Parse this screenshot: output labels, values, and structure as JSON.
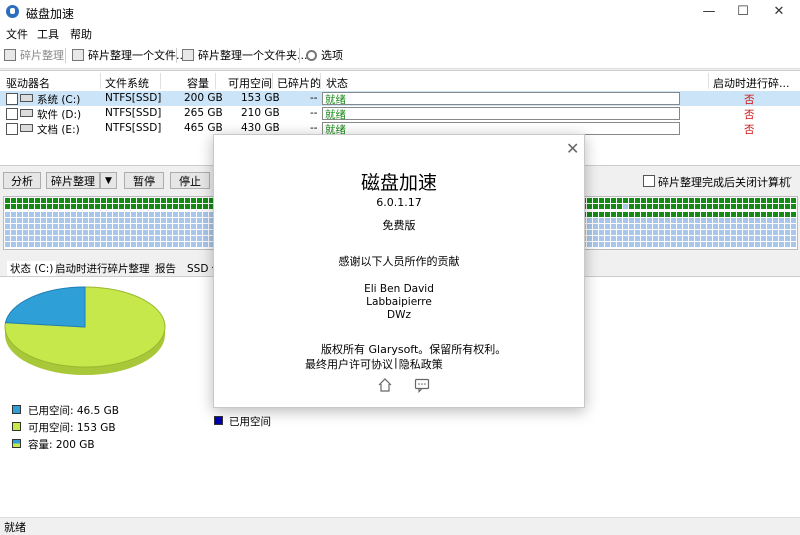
{
  "window": {
    "title": "磁盘加速",
    "min": "—",
    "max": "☐",
    "close": "✕"
  },
  "menu": [
    "文件",
    "工具",
    "帮助"
  ],
  "toolbar": {
    "defrag": "碎片整理",
    "defrag_file": "碎片整理一个文件...",
    "defrag_folder": "碎片整理一个文件夹...",
    "options": "选项"
  },
  "columns": {
    "drive": "驱动器名",
    "fs": "文件系统",
    "capacity": "容量",
    "free": "可用空间",
    "fragmented": "已碎片的",
    "status": "状态",
    "boot": "启动时进行碎..."
  },
  "drives": [
    {
      "name": "系统 (C:)",
      "fs": "NTFS[SSD]",
      "capacity": "200 GB",
      "free": "153 GB",
      "frag": "--",
      "status": "就绪",
      "boot": "否"
    },
    {
      "name": "软件 (D:)",
      "fs": "NTFS[SSD]",
      "capacity": "265 GB",
      "free": "210 GB",
      "frag": "--",
      "status": "就绪",
      "boot": "否"
    },
    {
      "name": "文档 (E:)",
      "fs": "NTFS[SSD]",
      "capacity": "465 GB",
      "free": "430 GB",
      "frag": "--",
      "status": "就绪",
      "boot": "否"
    }
  ],
  "actions": {
    "analyze": "分析",
    "defrag": "碎片整理",
    "dropdown": "▼",
    "pause": "暂停",
    "stop": "停止",
    "shutdown_label": "碎片整理完成后关闭计算机"
  },
  "tabs": [
    "状态 (C:)",
    "启动时进行碎片整理",
    "报告",
    "SSD 优"
  ],
  "legend": {
    "used": "已用空间: 46.5 GB",
    "free": "可用空间: 153 GB",
    "capacity": "容量: 200 GB",
    "used_right": "已用空间"
  },
  "pie": {
    "used_fraction": 0.2325,
    "colors": {
      "used": "#2f9fd8",
      "free": "#c6e84a",
      "cap_a": "#2f9fd8",
      "cap_b": "#c6e84a"
    }
  },
  "colors": {
    "map_used": "#158a15",
    "map_free": "#a9c7ec",
    "status_ok": "#1a8a1a",
    "no": "#d01010",
    "used_right": "#0000b0"
  },
  "statusbar": "就绪",
  "about": {
    "name": "磁盘加速",
    "version": "6.0.1.17",
    "edition": "免费版",
    "thanks": "感谢以下人员所作的贡献",
    "contributors": [
      "Eli Ben David",
      "Labbaipierre",
      "DWz"
    ],
    "copyright": "版权所有 Glarysoft。保留所有权利。",
    "eula": "最终用户许可协议",
    "divider": "|",
    "privacy": "隐私政策",
    "close": "✕"
  }
}
